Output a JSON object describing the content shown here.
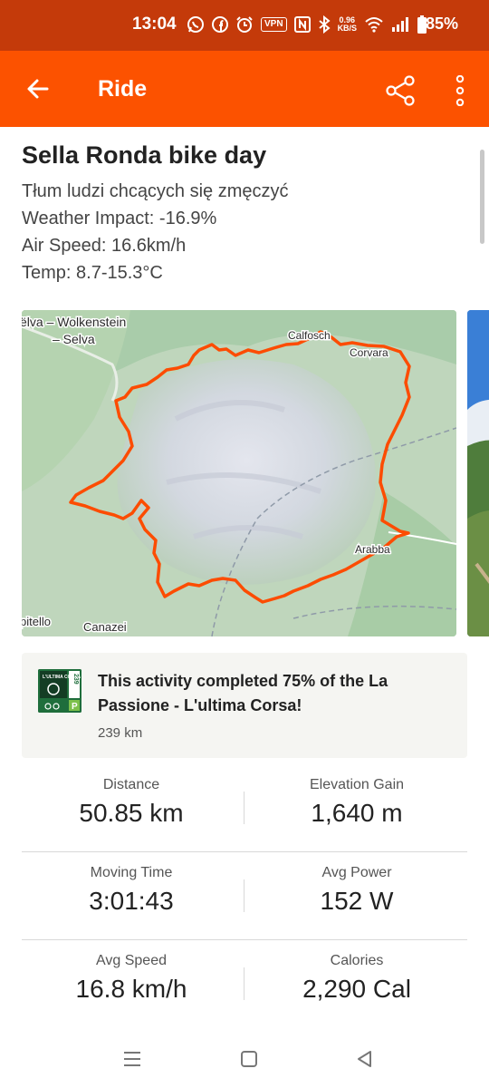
{
  "status_bar": {
    "time": "13:04",
    "vpn": "VPN",
    "net_speed_value": "0.96",
    "net_speed_unit": "KB/S",
    "battery": "85%",
    "icons": [
      "whatsapp-icon",
      "facebook-icon",
      "alarm-icon",
      "vpn-icon",
      "nfc-icon",
      "bluetooth-icon",
      "wifi-icon",
      "signal-icon",
      "battery-icon"
    ]
  },
  "app_bar": {
    "title": "Ride",
    "background": "#fc5200",
    "icons": [
      "back-arrow-icon",
      "share-icon",
      "more-vertical-icon"
    ]
  },
  "activity": {
    "title": "Sella Ronda bike day",
    "description_lines": [
      "Tłum ludzi chcących się zmęczyć",
      "Weather Impact: -16.9%",
      "Air Speed: 16.6km/h",
      "Temp: 8.7-15.3°C"
    ]
  },
  "map": {
    "labels": {
      "selva_line1": "ëlva – Wolkenstein",
      "selva_line2": "– Selva",
      "colfosco": "Calfosch",
      "corvara": "Corvara",
      "arabba": "Arabba",
      "campitello": "pitello",
      "canazei": "Canazei"
    },
    "route_color": "#fc4c02"
  },
  "challenge": {
    "text": "This activity completed 75% of the La Passione - L'ultima Corsa!",
    "distance": "239 km",
    "badge_text_top": "L'ULTIMA CORSA",
    "badge_km": "239",
    "badge_letter": "P"
  },
  "stats": [
    {
      "label": "Distance",
      "value": "50.85 km"
    },
    {
      "label": "Elevation Gain",
      "value": "1,640 m"
    },
    {
      "label": "Moving Time",
      "value": "3:01:43"
    },
    {
      "label": "Avg Power",
      "value": "152 W"
    },
    {
      "label": "Avg Speed",
      "value": "16.8 km/h"
    },
    {
      "label": "Calories",
      "value": "2,290 Cal"
    }
  ],
  "nav": {
    "icons": [
      "recent-apps-icon",
      "home-icon",
      "back-icon"
    ]
  }
}
